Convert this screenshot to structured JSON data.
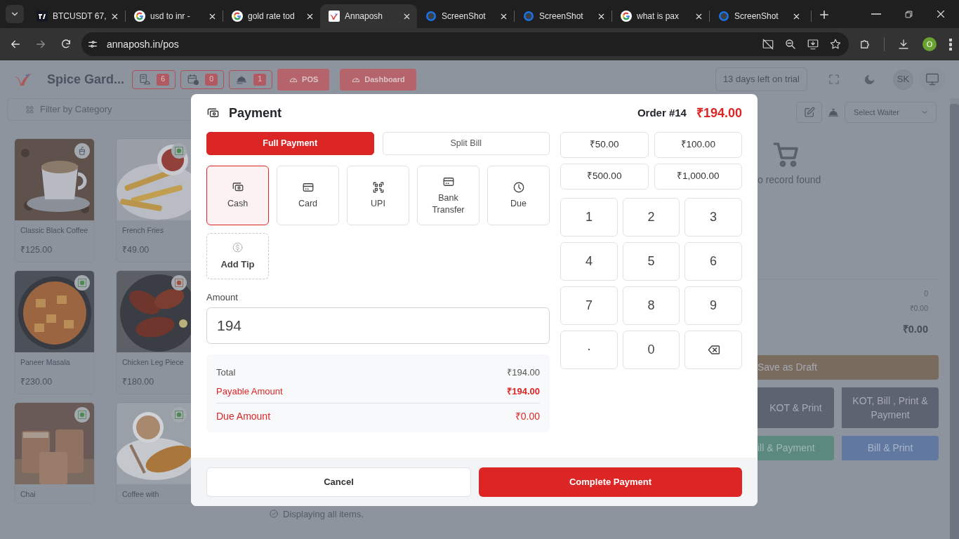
{
  "browser": {
    "tabs": [
      {
        "title": "BTCUSDT 67,",
        "kind": "dark",
        "selected": false
      },
      {
        "title": "usd to inr -",
        "kind": "multicolor",
        "selected": false
      },
      {
        "title": "gold rate tod",
        "kind": "multicolor",
        "selected": false
      },
      {
        "title": "Annaposh",
        "kind": "app",
        "selected": true
      },
      {
        "title": "ScreenShot",
        "kind": "blue",
        "selected": false
      },
      {
        "title": "ScreenShot",
        "kind": "blue",
        "selected": false
      },
      {
        "title": "what is pax",
        "kind": "multicolor",
        "selected": false
      },
      {
        "title": "ScreenShot",
        "kind": "blue",
        "selected": false
      }
    ],
    "url": "annaposh.in/pos",
    "profile": "O"
  },
  "header": {
    "restaurant": "Spice Gard...",
    "counters": [
      {
        "kind": "orders",
        "count": "6"
      },
      {
        "kind": "reservations",
        "count": "0"
      },
      {
        "kind": "service",
        "count": "1"
      }
    ],
    "nav": [
      {
        "label": "POS"
      },
      {
        "label": "Dashboard"
      }
    ],
    "trial": "13 days left on trial",
    "avatar": "SK"
  },
  "filter": {
    "placeholder": "Filter by Category"
  },
  "products": [
    {
      "name": "Classic Black Coffee",
      "price": "₹125.00",
      "kind": "beverage"
    },
    {
      "name": "French Fries",
      "price": "₹49.00",
      "kind": "veg"
    },
    {
      "name": "Paneer Masala",
      "price": "₹230.00",
      "kind": "veg"
    },
    {
      "name": "Chicken Leg Piece",
      "price": "₹180.00",
      "kind": "non-veg"
    },
    {
      "name": "Chai",
      "kind": "veg"
    },
    {
      "name": "Coffee with",
      "kind": "veg"
    }
  ],
  "list_note": "Displaying all items.",
  "cart": {
    "waiter": {
      "placeholder": "Select Waiter"
    },
    "empty": "o record found",
    "totals": [
      "0",
      "₹0.00",
      "₹0.00"
    ],
    "actions": [
      {
        "label": "Save as Draft",
        "kind": "draft"
      },
      {
        "label": "KOT & Print",
        "kind": "dark"
      },
      {
        "label": "KOT, Bill , Print & Payment",
        "kind": "dark"
      },
      {
        "label": "ill & Payment",
        "kind": "green"
      },
      {
        "label": "Bill & Print",
        "kind": "blue"
      }
    ]
  },
  "modal": {
    "title": "Payment",
    "order": "Order #14",
    "total": "₹194.00",
    "modes": [
      {
        "label": "Full Payment",
        "selected": true
      },
      {
        "label": "Split Bill",
        "selected": false
      }
    ],
    "methods": [
      {
        "label": "Cash",
        "kind": "cash",
        "selected": true
      },
      {
        "label": "Card",
        "kind": "card",
        "selected": false
      },
      {
        "label": "UPI",
        "kind": "upi",
        "selected": false
      },
      {
        "label": "Bank Transfer",
        "kind": "bank",
        "selected": false
      },
      {
        "label": "Due",
        "kind": "due",
        "selected": false
      }
    ],
    "tip": "Add Tip",
    "amount": {
      "label": "Amount",
      "value": "194"
    },
    "summary": [
      {
        "label": "Total",
        "value": "₹194.00",
        "kind": "plain"
      },
      {
        "label": "Payable Amount",
        "value": "₹194.00",
        "kind": "payable"
      },
      {
        "label": "Due Amount",
        "value": "₹0.00",
        "kind": "due"
      }
    ],
    "quick_amounts": [
      "₹50.00",
      "₹100.00",
      "₹500.00",
      "₹1,000.00"
    ],
    "keys": [
      {
        "kind": "digit",
        "label": "1"
      },
      {
        "kind": "digit",
        "label": "2"
      },
      {
        "kind": "digit",
        "label": "3"
      },
      {
        "kind": "digit",
        "label": "4"
      },
      {
        "kind": "digit",
        "label": "5"
      },
      {
        "kind": "digit",
        "label": "6"
      },
      {
        "kind": "digit",
        "label": "7"
      },
      {
        "kind": "digit",
        "label": "8"
      },
      {
        "kind": "digit",
        "label": "9"
      },
      {
        "kind": "digit",
        "label": "."
      },
      {
        "kind": "digit",
        "label": "0"
      },
      {
        "kind": "backspace"
      }
    ],
    "cancel": "Cancel",
    "submit": "Complete Payment"
  }
}
